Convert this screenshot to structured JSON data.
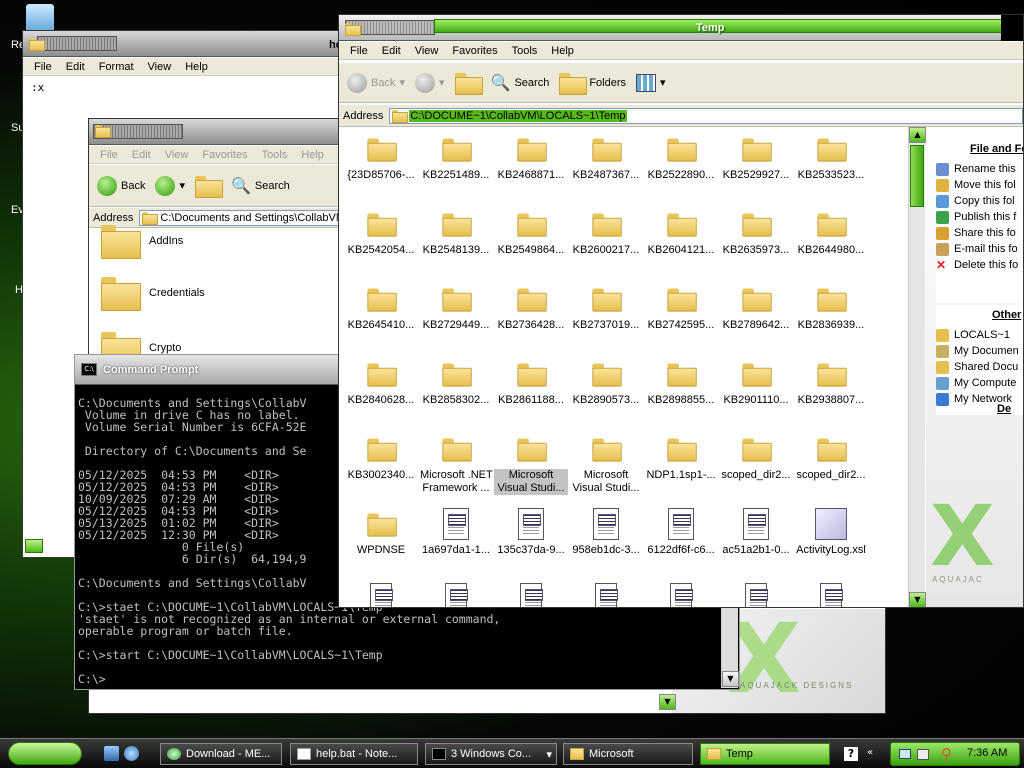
{
  "desktop": {
    "icons": [
      {
        "label": "Re"
      },
      {
        "label": "Su"
      },
      {
        "label": "Ev"
      },
      {
        "label": "H"
      }
    ]
  },
  "notepad": {
    "title": "he",
    "menu": [
      "File",
      "Edit",
      "Format",
      "View",
      "Help"
    ],
    "content": ":x"
  },
  "explorer_back": {
    "menu": [
      "File",
      "Edit",
      "View",
      "Favorites",
      "Tools",
      "Help"
    ],
    "back_label": "Back",
    "search_label": "Search",
    "address_label": "Address",
    "address_value": "C:\\Documents and Settings\\CollabVM",
    "folders": [
      "AddIns",
      "Credentials",
      "Crypto"
    ]
  },
  "cmd": {
    "title": "Command Prompt",
    "lines": [
      "C:\\Documents and Settings\\CollabV",
      " Volume in drive C has no label.",
      " Volume Serial Number is 6CFA-52E",
      "",
      " Directory of C:\\Documents and Se",
      "",
      "05/12/2025  04:53 PM    <DIR>",
      "05/12/2025  04:53 PM    <DIR>",
      "10/09/2025  07:29 AM    <DIR>",
      "05/12/2025  04:53 PM    <DIR>",
      "05/13/2025  01:02 PM    <DIR>",
      "05/12/2025  12:30 PM    <DIR>",
      "               0 File(s)",
      "               6 Dir(s)  64,194,9",
      "",
      "C:\\Documents and Settings\\CollabV",
      "",
      "C:\\>staet C:\\DOCUME~1\\CollabVM\\LOCALS~1\\Temp",
      "'staet' is not recognized as an internal or external command,",
      "operable program or batch file.",
      "",
      "C:\\>start C:\\DOCUME~1\\CollabVM\\LOCALS~1\\Temp",
      "",
      "C:\\>"
    ]
  },
  "temp": {
    "title": "Temp",
    "menu": [
      "File",
      "Edit",
      "View",
      "Favorites",
      "Tools",
      "Help"
    ],
    "back_label": "Back",
    "search_label": "Search",
    "folders_label": "Folders",
    "address_label": "Address",
    "address_value": "C:\\DOCUME~1\\CollabVM\\LOCALS~1\\Temp",
    "items": [
      {
        "label": "{23D85706-...",
        "type": "folder"
      },
      {
        "label": "KB2251489...",
        "type": "folder"
      },
      {
        "label": "KB2468871...",
        "type": "folder"
      },
      {
        "label": "KB2487367...",
        "type": "folder"
      },
      {
        "label": "KB2522890...",
        "type": "folder"
      },
      {
        "label": "KB2529927...",
        "type": "folder"
      },
      {
        "label": "KB2533523...",
        "type": "folder"
      },
      {
        "label": "KB2542054...",
        "type": "folder"
      },
      {
        "label": "KB2548139...",
        "type": "folder"
      },
      {
        "label": "KB2549864...",
        "type": "folder"
      },
      {
        "label": "KB2600217...",
        "type": "folder"
      },
      {
        "label": "KB2604121...",
        "type": "folder"
      },
      {
        "label": "KB2635973...",
        "type": "folder"
      },
      {
        "label": "KB2644980...",
        "type": "folder"
      },
      {
        "label": "KB2645410...",
        "type": "folder"
      },
      {
        "label": "KB2729449...",
        "type": "folder"
      },
      {
        "label": "KB2736428...",
        "type": "folder"
      },
      {
        "label": "KB2737019...",
        "type": "folder"
      },
      {
        "label": "KB2742595...",
        "type": "folder"
      },
      {
        "label": "KB2789642...",
        "type": "folder"
      },
      {
        "label": "KB2836939...",
        "type": "folder"
      },
      {
        "label": "KB2840628...",
        "type": "folder"
      },
      {
        "label": "KB2858302...",
        "type": "folder"
      },
      {
        "label": "KB2861188...",
        "type": "folder"
      },
      {
        "label": "KB2890573...",
        "type": "folder"
      },
      {
        "label": "KB2898855...",
        "type": "folder"
      },
      {
        "label": "KB2901110...",
        "type": "folder"
      },
      {
        "label": "KB2938807...",
        "type": "folder"
      },
      {
        "label": "KB3002340...",
        "type": "folder"
      },
      {
        "label": "Microsoft .NET",
        "label2": "Framework ...",
        "type": "folder"
      },
      {
        "label": "Microsoft",
        "label2": "Visual Studi...",
        "type": "folder",
        "selected": true
      },
      {
        "label": "Microsoft",
        "label2": "Visual Studi...",
        "type": "folder"
      },
      {
        "label": "NDP1.1sp1-...",
        "type": "folder"
      },
      {
        "label": "scoped_dir2...",
        "type": "folder"
      },
      {
        "label": "scoped_dir2...",
        "type": "folder"
      },
      {
        "label": "WPDNSE",
        "type": "folder"
      },
      {
        "label": "1a697da1-1...",
        "type": "file"
      },
      {
        "label": "135c37da-9...",
        "type": "file"
      },
      {
        "label": "958eb1dc-3...",
        "type": "file"
      },
      {
        "label": "6122df6f-c6...",
        "type": "file"
      },
      {
        "label": "ac51a2b1-0...",
        "type": "file"
      },
      {
        "label": "ActivityLog.xsl",
        "type": "xsl"
      }
    ],
    "tasks_title": "File and Fo",
    "tasks": [
      {
        "label": "Rename this",
        "icon": "rename-icon"
      },
      {
        "label": "Move this fol",
        "icon": "move-icon"
      },
      {
        "label": "Copy this fol",
        "icon": "copy-icon"
      },
      {
        "label": "Publish this f",
        "icon": "publish-icon"
      },
      {
        "label": "Share this fo",
        "icon": "share-icon"
      },
      {
        "label": "E-mail this fo",
        "icon": "email-icon"
      },
      {
        "label": "Delete this fo",
        "icon": "delete-icon"
      }
    ],
    "other_title": "Other",
    "other": [
      {
        "label": "LOCALS~1",
        "icon": "folder-icon"
      },
      {
        "label": "My Documen",
        "icon": "documents-icon"
      },
      {
        "label": "Shared Docu",
        "icon": "folder-icon"
      },
      {
        "label": "My Compute",
        "icon": "computer-icon"
      },
      {
        "label": "My Network",
        "icon": "network-icon"
      }
    ],
    "details_title": "De"
  },
  "watermark": {
    "text": "AQUAJACK DESIGNS"
  },
  "taskbar": {
    "buttons": [
      {
        "label": "Download - ME...",
        "icon": "browser-icon"
      },
      {
        "label": "help.bat - Note...",
        "icon": "notepad-icon"
      },
      {
        "label": "3 Windows Co...",
        "icon": "cmd-icon"
      },
      {
        "label": "Microsoft",
        "icon": "folder-icon"
      },
      {
        "label": "Temp",
        "icon": "folder-icon",
        "active": true
      }
    ],
    "clock": "7:36 AM"
  }
}
